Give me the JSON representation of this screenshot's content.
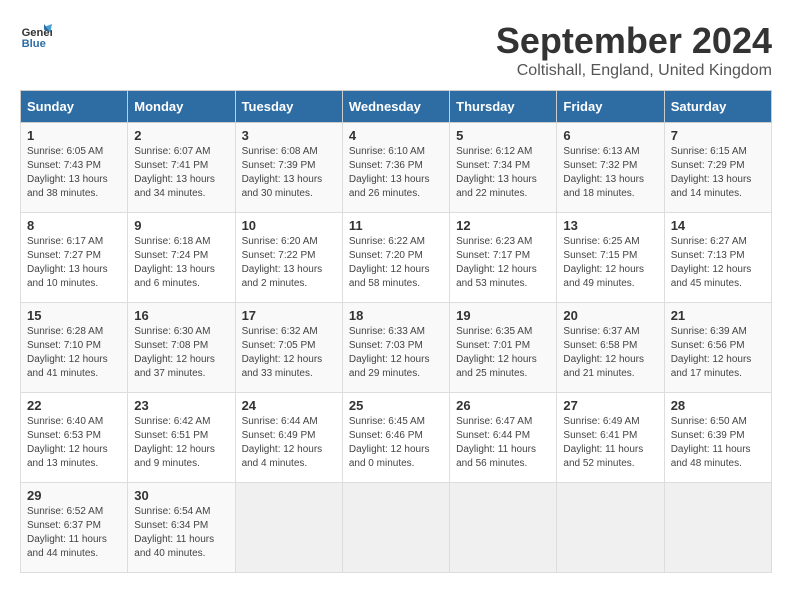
{
  "logo": {
    "line1": "General",
    "line2": "Blue"
  },
  "title": "September 2024",
  "location": "Coltishall, England, United Kingdom",
  "weekdays": [
    "Sunday",
    "Monday",
    "Tuesday",
    "Wednesday",
    "Thursday",
    "Friday",
    "Saturday"
  ],
  "weeks": [
    [
      {
        "day": "1",
        "sunrise": "6:05 AM",
        "sunset": "7:43 PM",
        "daylight": "13 hours and 38 minutes."
      },
      {
        "day": "2",
        "sunrise": "6:07 AM",
        "sunset": "7:41 PM",
        "daylight": "13 hours and 34 minutes."
      },
      {
        "day": "3",
        "sunrise": "6:08 AM",
        "sunset": "7:39 PM",
        "daylight": "13 hours and 30 minutes."
      },
      {
        "day": "4",
        "sunrise": "6:10 AM",
        "sunset": "7:36 PM",
        "daylight": "13 hours and 26 minutes."
      },
      {
        "day": "5",
        "sunrise": "6:12 AM",
        "sunset": "7:34 PM",
        "daylight": "13 hours and 22 minutes."
      },
      {
        "day": "6",
        "sunrise": "6:13 AM",
        "sunset": "7:32 PM",
        "daylight": "13 hours and 18 minutes."
      },
      {
        "day": "7",
        "sunrise": "6:15 AM",
        "sunset": "7:29 PM",
        "daylight": "13 hours and 14 minutes."
      }
    ],
    [
      {
        "day": "8",
        "sunrise": "6:17 AM",
        "sunset": "7:27 PM",
        "daylight": "13 hours and 10 minutes."
      },
      {
        "day": "9",
        "sunrise": "6:18 AM",
        "sunset": "7:24 PM",
        "daylight": "13 hours and 6 minutes."
      },
      {
        "day": "10",
        "sunrise": "6:20 AM",
        "sunset": "7:22 PM",
        "daylight": "13 hours and 2 minutes."
      },
      {
        "day": "11",
        "sunrise": "6:22 AM",
        "sunset": "7:20 PM",
        "daylight": "12 hours and 58 minutes."
      },
      {
        "day": "12",
        "sunrise": "6:23 AM",
        "sunset": "7:17 PM",
        "daylight": "12 hours and 53 minutes."
      },
      {
        "day": "13",
        "sunrise": "6:25 AM",
        "sunset": "7:15 PM",
        "daylight": "12 hours and 49 minutes."
      },
      {
        "day": "14",
        "sunrise": "6:27 AM",
        "sunset": "7:13 PM",
        "daylight": "12 hours and 45 minutes."
      }
    ],
    [
      {
        "day": "15",
        "sunrise": "6:28 AM",
        "sunset": "7:10 PM",
        "daylight": "12 hours and 41 minutes."
      },
      {
        "day": "16",
        "sunrise": "6:30 AM",
        "sunset": "7:08 PM",
        "daylight": "12 hours and 37 minutes."
      },
      {
        "day": "17",
        "sunrise": "6:32 AM",
        "sunset": "7:05 PM",
        "daylight": "12 hours and 33 minutes."
      },
      {
        "day": "18",
        "sunrise": "6:33 AM",
        "sunset": "7:03 PM",
        "daylight": "12 hours and 29 minutes."
      },
      {
        "day": "19",
        "sunrise": "6:35 AM",
        "sunset": "7:01 PM",
        "daylight": "12 hours and 25 minutes."
      },
      {
        "day": "20",
        "sunrise": "6:37 AM",
        "sunset": "6:58 PM",
        "daylight": "12 hours and 21 minutes."
      },
      {
        "day": "21",
        "sunrise": "6:39 AM",
        "sunset": "6:56 PM",
        "daylight": "12 hours and 17 minutes."
      }
    ],
    [
      {
        "day": "22",
        "sunrise": "6:40 AM",
        "sunset": "6:53 PM",
        "daylight": "12 hours and 13 minutes."
      },
      {
        "day": "23",
        "sunrise": "6:42 AM",
        "sunset": "6:51 PM",
        "daylight": "12 hours and 9 minutes."
      },
      {
        "day": "24",
        "sunrise": "6:44 AM",
        "sunset": "6:49 PM",
        "daylight": "12 hours and 4 minutes."
      },
      {
        "day": "25",
        "sunrise": "6:45 AM",
        "sunset": "6:46 PM",
        "daylight": "12 hours and 0 minutes."
      },
      {
        "day": "26",
        "sunrise": "6:47 AM",
        "sunset": "6:44 PM",
        "daylight": "11 hours and 56 minutes."
      },
      {
        "day": "27",
        "sunrise": "6:49 AM",
        "sunset": "6:41 PM",
        "daylight": "11 hours and 52 minutes."
      },
      {
        "day": "28",
        "sunrise": "6:50 AM",
        "sunset": "6:39 PM",
        "daylight": "11 hours and 48 minutes."
      }
    ],
    [
      {
        "day": "29",
        "sunrise": "6:52 AM",
        "sunset": "6:37 PM",
        "daylight": "11 hours and 44 minutes."
      },
      {
        "day": "30",
        "sunrise": "6:54 AM",
        "sunset": "6:34 PM",
        "daylight": "11 hours and 40 minutes."
      },
      null,
      null,
      null,
      null,
      null
    ]
  ]
}
